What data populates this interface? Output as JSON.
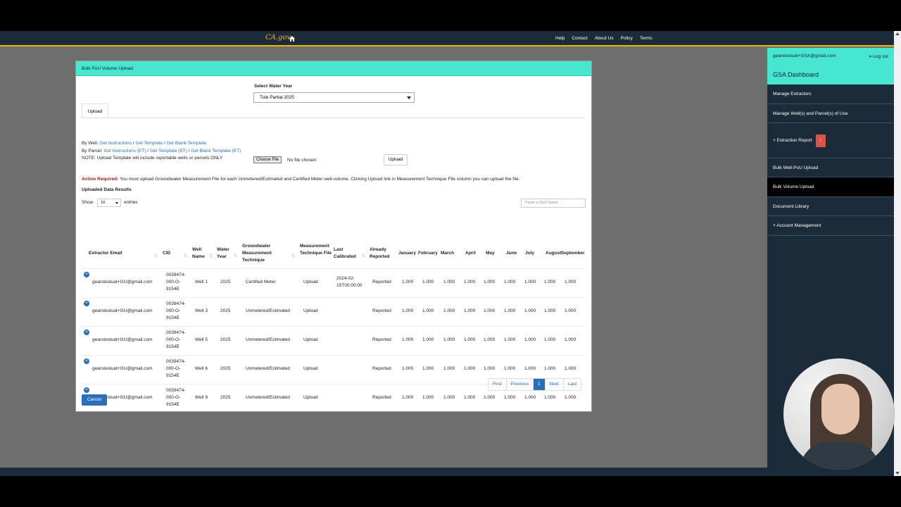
{
  "topnav": {
    "logo": "CA.gov",
    "menu": [
      "Help",
      "Contact",
      "About Us",
      "Policy",
      "Terms"
    ]
  },
  "sidebar": {
    "email": "gearstestuat+GSA@gmail.com",
    "logout": "Log out",
    "title": "GSA Dashboard",
    "items": [
      {
        "label": "Manage Extractors"
      },
      {
        "label": "Manage Well(s) and Parcel(s) of Use"
      },
      {
        "label": "+ Extraction Report",
        "badge": "!"
      },
      {
        "label": "Bulk Well-PoU Upload"
      },
      {
        "label": "Bulk Volume Upload"
      },
      {
        "label": "Document Library"
      },
      {
        "label": "+ Account Management"
      }
    ]
  },
  "modal": {
    "title": "Bulk PoU Volume Upload",
    "select_label": "Select Water Year",
    "select_value": "Tule Partial 2025",
    "tab": "Upload",
    "by_well_prefix": "By Well: ",
    "by_well_links": [
      "Get Instructions",
      "Get Template",
      "Get Blank Template"
    ],
    "by_parcel_prefix": "By Parcel: ",
    "by_parcel_links": [
      "Get Instructions (ET)",
      "Get Template (ET)",
      "Get Blank Template (ET)"
    ],
    "note": "NOTE: Upload Template will include reportable wells or parcels ONLY",
    "choose_file": "Choose File",
    "no_file": "No file chosen",
    "upload_button": "Upload",
    "action_required_label": "Action Required:",
    "action_required_text": "You must upload Groundwater Measurement File for each Unmetered/Estimated and Certified Meter well-volume. Clicking Upload link in Measurement Technique File column you can upload the file.",
    "results_title": "Uploaded Data Results",
    "show": "Show",
    "entries_value": "10",
    "entries": "entries",
    "search_placeholder": "Paste a Well Name...",
    "cancel": "Cancel"
  },
  "table": {
    "headers": [
      "Extractor Email",
      "CID",
      "Well Name",
      "Water Year",
      "Groundwater Measurement Technique",
      "Measurement Technique File",
      "Last Calibrated",
      "Already Reported",
      "January",
      "February",
      "March",
      "April",
      "May",
      "June",
      "July",
      "August",
      "September"
    ],
    "rows": [
      {
        "email": "gearstestuat+GU@gmail.com",
        "cid": "0039474-000-O-9154E",
        "well": "Well 1",
        "year": "2025",
        "technique": "Certified Meter",
        "file": "Upload",
        "calibrated": "2024-02-15T00:00:00",
        "reported": "Reported",
        "months": [
          "1.000",
          "1.000",
          "1.000",
          "1.000",
          "1.000",
          "1.000",
          "1.000",
          "1.000",
          "1.000"
        ]
      },
      {
        "email": "gearstestuat+GU@gmail.com",
        "cid": "0039474-000-O-9154E",
        "well": "Well 3",
        "year": "2025",
        "technique": "Unmetered/Estimated",
        "file": "Upload",
        "calibrated": "",
        "reported": "Reported",
        "months": [
          "1.000",
          "1.000",
          "1.000",
          "1.000",
          "1.000",
          "1.000",
          "1.000",
          "1.000",
          "1.000"
        ]
      },
      {
        "email": "gearstestuat+GU@gmail.com",
        "cid": "0039474-000-O-9154E",
        "well": "Well 5",
        "year": "2025",
        "technique": "Unmetered/Estimated",
        "file": "Upload",
        "calibrated": "",
        "reported": "Reported",
        "months": [
          "1.000",
          "1.000",
          "1.000",
          "1.000",
          "1.000",
          "1.000",
          "1.000",
          "1.000",
          "1.000"
        ]
      },
      {
        "email": "gearstestuat+GU@gmail.com",
        "cid": "0039474-000-O-9154E",
        "well": "Well 6",
        "year": "2025",
        "technique": "Unmetered/Estimated",
        "file": "Upload",
        "calibrated": "",
        "reported": "Reported",
        "months": [
          "1.000",
          "1.000",
          "1.000",
          "1.000",
          "1.000",
          "1.000",
          "1.000",
          "1.000",
          "1.000"
        ]
      },
      {
        "email": "gearstestuat+GU@gmail.com",
        "cid": "0039474-000-O-9154E",
        "well": "Well 9",
        "year": "2025",
        "technique": "Unmetered/Estimated",
        "file": "Upload",
        "calibrated": "",
        "reported": "Reported",
        "months": [
          "1.000",
          "1.000",
          "1.000",
          "1.000",
          "1.000",
          "1.000",
          "1.000",
          "1.000",
          "1.000"
        ]
      }
    ]
  },
  "pager": [
    "First",
    "Previous",
    "1",
    "Next",
    "Last"
  ],
  "colors": {
    "accent": "#46e6d0",
    "nav": "#1c2b3a",
    "link": "#2a6fb8",
    "gold": "#f0b400",
    "danger": "#d9534f"
  }
}
